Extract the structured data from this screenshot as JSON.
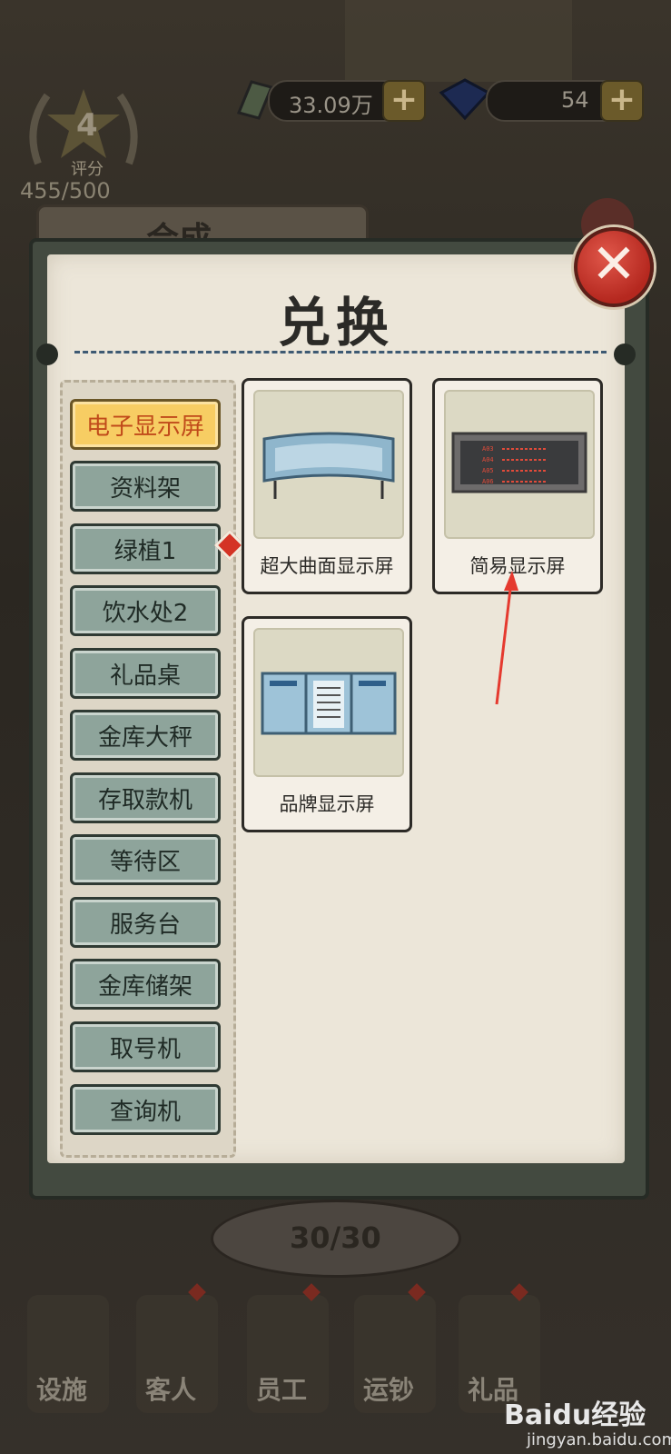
{
  "hud": {
    "rating_value": "4",
    "rating_label": "评分",
    "rating_progress": "455/500",
    "gold_amount": "33.09万",
    "gem_amount": "54"
  },
  "background": {
    "panel_title": "合成",
    "pager": "30/30",
    "nav": [
      "设施",
      "客人",
      "员工",
      "运钞",
      "礼品"
    ]
  },
  "dialog": {
    "title": "兑换",
    "close_icon": "close-x-icon",
    "categories": [
      {
        "label": "电子显示屏",
        "active": true
      },
      {
        "label": "资料架"
      },
      {
        "label": "绿植1",
        "badge": true
      },
      {
        "label": "饮水处2"
      },
      {
        "label": "礼品桌"
      },
      {
        "label": "金库大秤"
      },
      {
        "label": "存取款机"
      },
      {
        "label": "等待区"
      },
      {
        "label": "服务台"
      },
      {
        "label": "金库储架"
      },
      {
        "label": "取号机"
      },
      {
        "label": "查询机"
      }
    ],
    "items": [
      {
        "name": "超大曲面显示屏",
        "icon": "curved-screen-icon"
      },
      {
        "name": "简易显示屏",
        "icon": "led-screen-icon"
      },
      {
        "name": "品牌显示屏",
        "icon": "brand-screen-icon"
      }
    ],
    "led_rows": [
      "A03",
      "A04",
      "A05",
      "A06"
    ]
  },
  "watermark": {
    "logo": "Baidu经验",
    "url": "jingyan.baidu.com"
  },
  "colors": {
    "accent_active": "#f7cd63",
    "category_button": "#8ea49b",
    "close_red": "#c0392b",
    "annotation_arrow": "#e53a2f"
  }
}
